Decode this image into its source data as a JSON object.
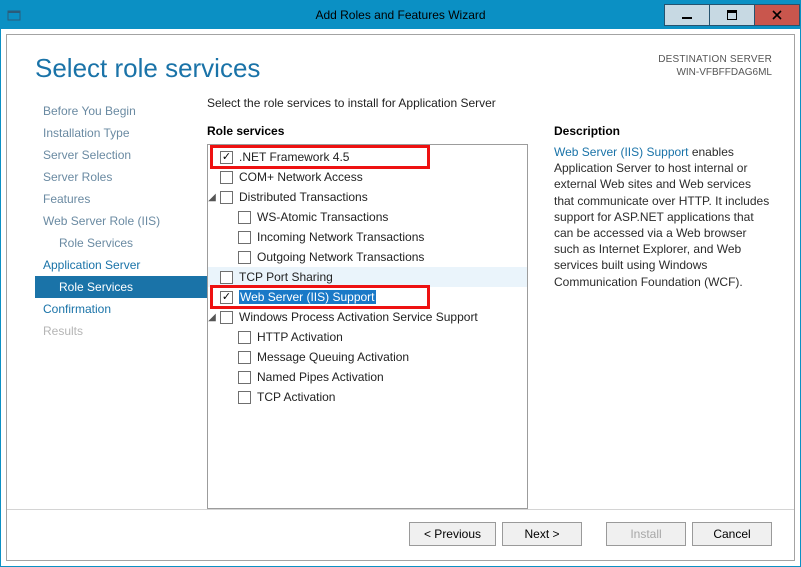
{
  "window": {
    "title": "Add Roles and Features Wizard"
  },
  "header": {
    "page_title": "Select role services",
    "destination_label": "DESTINATION SERVER",
    "destination_value": "WIN-VFBFFDAG6ML"
  },
  "nav": {
    "items": [
      {
        "label": "Before You Begin",
        "sub": false,
        "state": "muted"
      },
      {
        "label": "Installation Type",
        "sub": false,
        "state": "muted"
      },
      {
        "label": "Server Selection",
        "sub": false,
        "state": "muted"
      },
      {
        "label": "Server Roles",
        "sub": false,
        "state": "muted"
      },
      {
        "label": "Features",
        "sub": false,
        "state": "muted"
      },
      {
        "label": "Web Server Role (IIS)",
        "sub": false,
        "state": "muted"
      },
      {
        "label": "Role Services",
        "sub": true,
        "state": "muted"
      },
      {
        "label": "Application Server",
        "sub": false,
        "state": ""
      },
      {
        "label": "Role Services",
        "sub": true,
        "state": "selected"
      },
      {
        "label": "Confirmation",
        "sub": false,
        "state": ""
      },
      {
        "label": "Results",
        "sub": false,
        "state": "disabled"
      }
    ]
  },
  "main": {
    "prompt": "Select the role services to install for Application Server",
    "tree_label": "Role services",
    "tree": [
      {
        "level": 0,
        "label": ".NET Framework 4.5",
        "checked": true,
        "annot": true
      },
      {
        "level": 0,
        "label": "COM+ Network Access",
        "checked": false
      },
      {
        "level": 0,
        "label": "Distributed Transactions",
        "checked": false,
        "exp": "open"
      },
      {
        "level": 1,
        "label": "WS-Atomic Transactions",
        "checked": false
      },
      {
        "level": 1,
        "label": "Incoming Network Transactions",
        "checked": false
      },
      {
        "level": 1,
        "label": "Outgoing Network Transactions",
        "checked": false
      },
      {
        "level": 0,
        "label": "TCP Port Sharing",
        "checked": false,
        "hover": true
      },
      {
        "level": 0,
        "label": "Web Server (IIS) Support",
        "checked": true,
        "sel": true,
        "annot": true
      },
      {
        "level": 0,
        "label": "Windows Process Activation Service Support",
        "checked": false,
        "exp": "open"
      },
      {
        "level": 1,
        "label": "HTTP Activation",
        "checked": false
      },
      {
        "level": 1,
        "label": "Message Queuing Activation",
        "checked": false
      },
      {
        "level": 1,
        "label": "Named Pipes Activation",
        "checked": false
      },
      {
        "level": 1,
        "label": "TCP Activation",
        "checked": false
      }
    ],
    "desc_label": "Description",
    "desc_link": "Web Server (IIS) Support",
    "desc_text": " enables Application Server to host internal or external Web sites and Web services that communicate over HTTP. It includes support for ASP.NET applications that can be accessed via a Web browser such as Internet Explorer, and Web services built using Windows Communication Foundation (WCF)."
  },
  "footer": {
    "previous": "< Previous",
    "next": "Next >",
    "install": "Install",
    "cancel": "Cancel"
  }
}
